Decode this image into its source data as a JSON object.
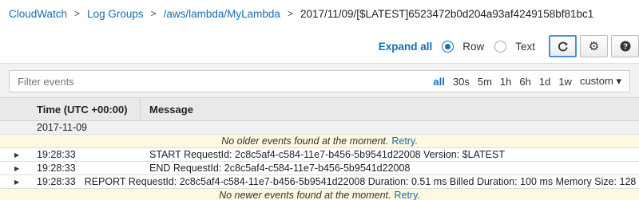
{
  "breadcrumb": {
    "items": [
      "CloudWatch",
      "Log Groups",
      "/aws/lambda/MyLambda"
    ],
    "separator": ">",
    "current": "2017/11/09/[$LATEST]6523472b0d204a93af4249158bf81bc1"
  },
  "toolbar": {
    "expand_all": "Expand all",
    "view_row": "Row",
    "view_text": "Text",
    "selected_view": "Row",
    "refresh_icon": "refresh-icon",
    "settings_icon": "gear-icon",
    "help_icon": "help-icon"
  },
  "filter": {
    "placeholder": "Filter events",
    "ranges": [
      "all",
      "30s",
      "5m",
      "1h",
      "6h",
      "1d",
      "1w",
      "custom ▾"
    ],
    "selected_range": "all"
  },
  "table": {
    "columns": [
      "Time (UTC +00:00)",
      "Message"
    ],
    "date_group": "2017-11-09",
    "older_notice": "No older events found at the moment.",
    "newer_notice": "No newer events found at the moment.",
    "retry": "Retry.",
    "events": [
      {
        "time": "19:28:33",
        "message": "START RequestId: 2c8c5af4-c584-11e7-b456-5b9541d22008 Version: $LATEST"
      },
      {
        "time": "19:28:33",
        "message": "END RequestId: 2c8c5af4-c584-11e7-b456-5b9541d22008"
      },
      {
        "time": "19:28:33",
        "message": "REPORT RequestId: 2c8c5af4-c584-11e7-b456-5b9541d22008 Duration: 0.51 ms Billed Duration: 100 ms Memory Size: 128 MB Max Memory Used: 20 MB"
      }
    ]
  },
  "colors": {
    "link": "#146eb4",
    "notice_bg": "#fff8e0",
    "header_bg": "#e9e9e9"
  }
}
